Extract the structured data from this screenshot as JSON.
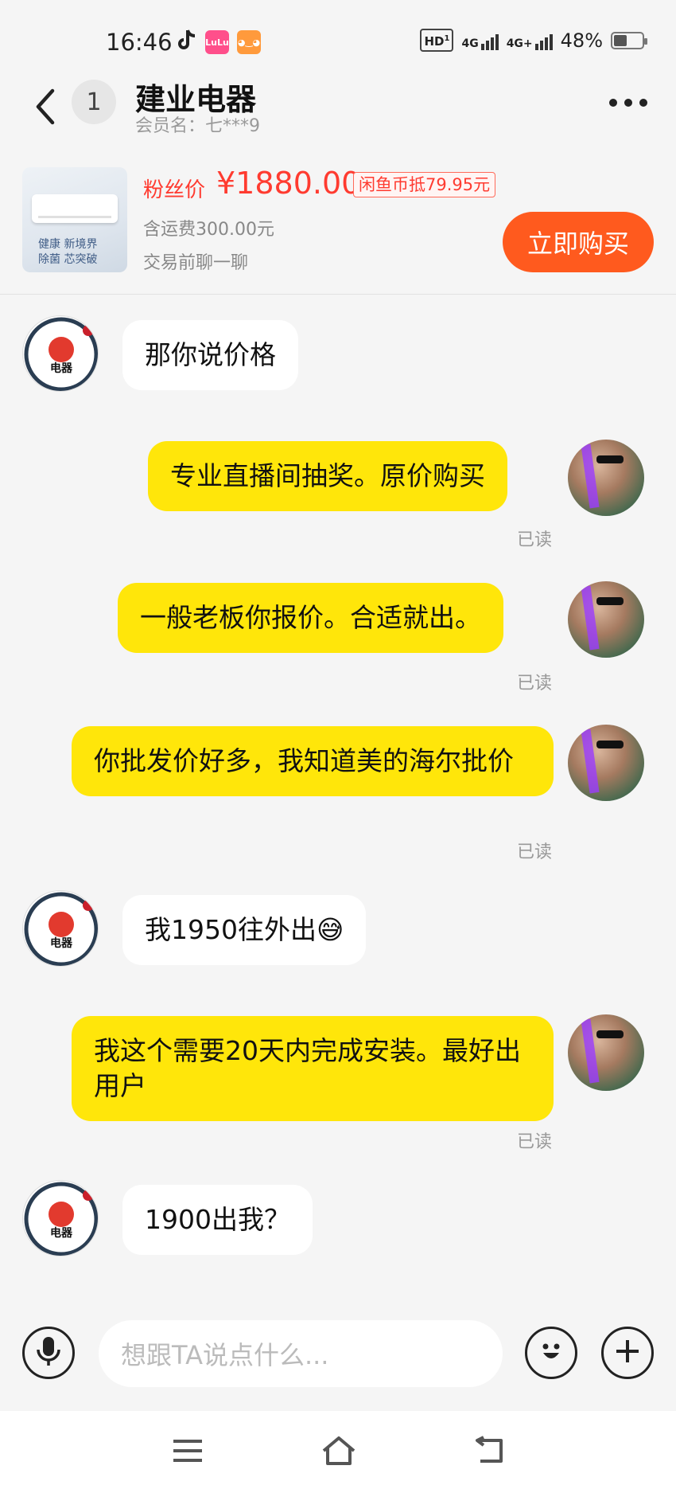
{
  "status_bar": {
    "time": "16:46",
    "apps": [
      "tiktok-icon",
      "lulu-icon",
      "taobao-icon"
    ],
    "hd": "HD",
    "hd_sub": "1",
    "net1": "4G",
    "net2": "4G+",
    "battery": "48%",
    "battery_level": 0.48
  },
  "header": {
    "unread_count": "1",
    "title": "建业电器",
    "subtitle": "会员名：七***9"
  },
  "product": {
    "thumb_text_line1": "健康 新境界",
    "thumb_text_line2": "除菌 芯突破",
    "price_label": "粉丝价",
    "price": "¥1880.00",
    "coin_tag": "闲鱼币抵79.95元",
    "shipping": "含运费300.00元",
    "chat_hint": "交易前聊一聊",
    "buy_label": "立即购买"
  },
  "messages": [
    {
      "from": "shop",
      "text": "那你说价格"
    },
    {
      "from": "me",
      "text": "专业直播间抽奖。原价购买",
      "status": "已读"
    },
    {
      "from": "me",
      "text": "一般老板你报价。合适就出。",
      "status": "已读"
    },
    {
      "from": "me",
      "text": "你批发价好多，我知道美的海尔批价",
      "status": "已读"
    },
    {
      "from": "shop",
      "text": "我1950往外出😅"
    },
    {
      "from": "me",
      "text": "我这个需要20天内完成安装。最好出用户",
      "status": "已读"
    },
    {
      "from": "shop",
      "text": "1900出我？"
    }
  ],
  "input": {
    "placeholder": "想跟TA说点什么..."
  },
  "colors": {
    "accent": "#ff5a1e",
    "price_red": "#ff3b30",
    "bubble_out": "#ffe60a",
    "bubble_in": "#ffffff"
  }
}
